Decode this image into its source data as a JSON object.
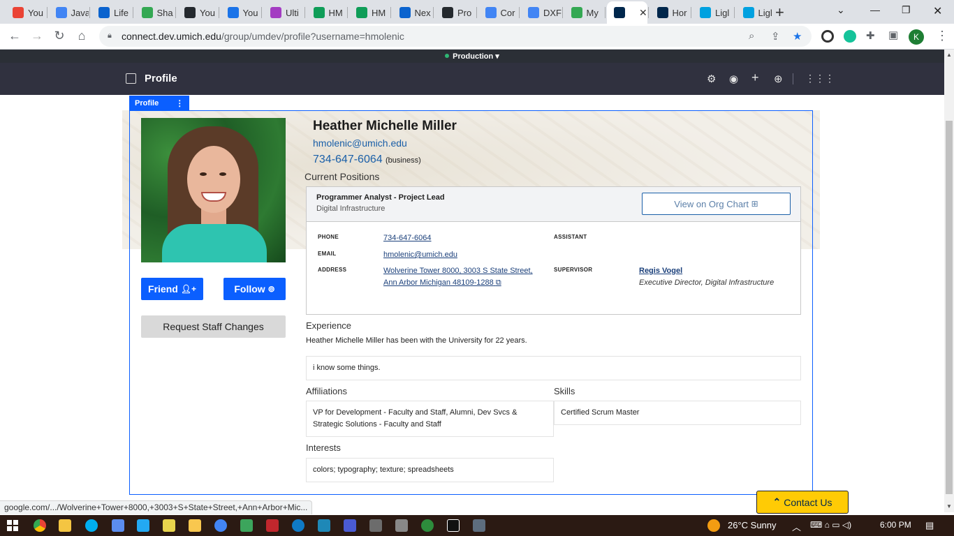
{
  "browser": {
    "tabs": [
      {
        "label": "You",
        "icon": "gmail-icon",
        "color": "#ea4335"
      },
      {
        "label": "Java",
        "icon": "google-docs-icon",
        "color": "#4285f4"
      },
      {
        "label": "Life",
        "icon": "liferay-icon",
        "color": "#0b63ce"
      },
      {
        "label": "Sha",
        "icon": "google-drive-icon",
        "color": "#34a853"
      },
      {
        "label": "You",
        "icon": "github-icon",
        "color": "#24292e"
      },
      {
        "label": "You",
        "icon": "google-calendar-icon",
        "color": "#1a73e8"
      },
      {
        "label": "Ulti",
        "icon": "extension-icon",
        "color": "#a33cc2"
      },
      {
        "label": "HM",
        "icon": "google-sheets-icon",
        "color": "#0f9d58"
      },
      {
        "label": "HM",
        "icon": "google-sheets-icon",
        "color": "#0f9d58"
      },
      {
        "label": "Nex",
        "icon": "liferay-icon",
        "color": "#0b63ce"
      },
      {
        "label": "Pro",
        "icon": "github-icon",
        "color": "#24292e"
      },
      {
        "label": "Cor",
        "icon": "google-docs-icon",
        "color": "#4285f4"
      },
      {
        "label": "DXF",
        "icon": "google-docs-icon",
        "color": "#4285f4"
      },
      {
        "label": "My",
        "icon": "google-drive-icon",
        "color": "#34a853"
      },
      {
        "label": "",
        "icon": "umich-icon",
        "color": "#00274c",
        "active": true
      },
      {
        "label": "Hor",
        "icon": "umich-icon",
        "color": "#00274c"
      },
      {
        "label": "Ligl",
        "icon": "salesforce-icon",
        "color": "#00a1e0"
      },
      {
        "label": "Ligl",
        "icon": "salesforce-icon",
        "color": "#00a1e0"
      }
    ],
    "url_host": "connect.dev.umich.edu",
    "url_path": "/group/umdev/profile?username=hmolenic",
    "profile_initial": "K",
    "status_url": "google.com/.../Wolverine+Tower+8000,+3003+S+State+Street,+Ann+Arbor+Mic..."
  },
  "env": {
    "label": "Production",
    "caret": "▾",
    "dot_color": "#2fb774"
  },
  "admin": {
    "title": "Profile"
  },
  "fragment": {
    "label": "Profile",
    "menu": "⋮"
  },
  "profile": {
    "name": "Heather Michelle Miller",
    "email": "hmolenic@umich.edu",
    "phone": "734-647-6064",
    "phone_type": "(business)",
    "friend_label": "Friend",
    "follow_label": "Follow",
    "request_label": "Request Staff Changes"
  },
  "positions": {
    "heading": "Current Positions",
    "title": "Programmer Analyst - Project Lead",
    "department": "Digital Infrastructure",
    "org_chart_label": "View on Org Chart",
    "labels": {
      "phone": "PHONE",
      "email": "EMAIL",
      "address": "ADDRESS",
      "assistant": "ASSISTANT",
      "supervisor": "SUPERVISOR"
    },
    "phone": "734-647-6064",
    "email": "hmolenic@umich.edu",
    "address_line1": "Wolverine Tower 8000, 3003 S State Street,",
    "address_line2": "Ann Arbor Michigan 48109-1288",
    "supervisor_name": "Regis Vogel",
    "supervisor_title": "Executive Director, Digital Infrastructure"
  },
  "experience": {
    "heading": "Experience",
    "tenure": "Heather Michelle Miller has been with the University for 22 years.",
    "text": "i know some things."
  },
  "affiliations": {
    "heading": "Affiliations",
    "text": "VP for Development - Faculty and Staff, Alumni, Dev Svcs & Strategic Solutions - Faculty and Staff"
  },
  "skills": {
    "heading": "Skills",
    "text": "Certified Scrum Master"
  },
  "interests": {
    "heading": "Interests",
    "text": "colors; typography; texture; spreadsheets"
  },
  "contact": {
    "label": "Contact Us"
  },
  "taskbar": {
    "weather": "26°C  Sunny",
    "time": "6:00 PM"
  }
}
